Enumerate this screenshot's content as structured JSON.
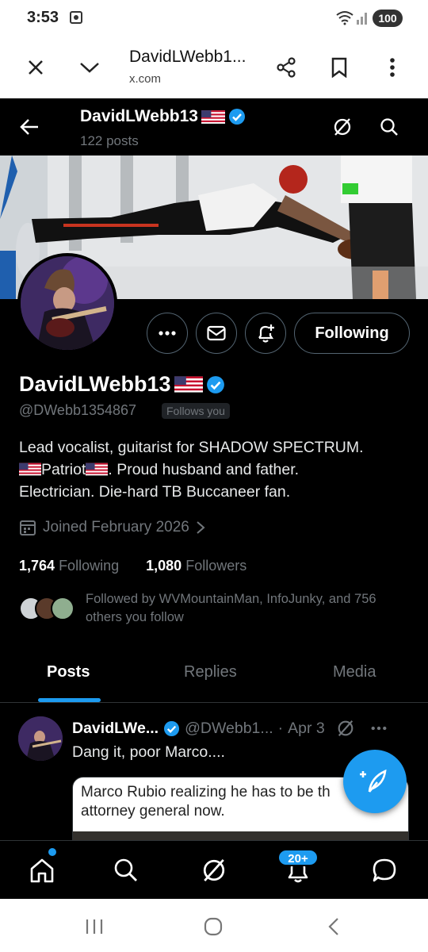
{
  "status_bar": {
    "time": "3:53",
    "battery": "100"
  },
  "browser": {
    "page_title": "DavidLWebb1...",
    "host": "x.com"
  },
  "header": {
    "name": "DavidLWebb13",
    "posts_count": "122 posts"
  },
  "profile": {
    "display_name": "DavidLWebb13",
    "handle": "@DWebb1354867",
    "follows_you": "Follows you",
    "follow_button": "Following",
    "bio_line1": "Lead vocalist, guitarist for SHADOW SPECTRUM.",
    "bio_patriot": "Patriot",
    "bio_line2_rest": ". Proud husband and father.",
    "bio_line3": "Electrician. Die-hard TB Buccaneer fan.",
    "joined": "Joined February 2026",
    "following_count": "1,764",
    "following_label": "Following",
    "followers_count": "1,080",
    "followers_label": "Followers",
    "followed_by": "Followed by WVMountainMan, InfoJunky, and 756 others you follow"
  },
  "tabs": [
    "Posts",
    "Replies",
    "Media"
  ],
  "active_tab": "Posts",
  "post": {
    "name": "DavidLWe...",
    "handle": "@DWebb1...",
    "separator": "·",
    "date": "Apr 3",
    "text": "Dang it, poor Marco....",
    "card_text": "Marco Rubio realizing he has to be th attorney general now."
  },
  "bottom_nav": {
    "notifications_badge": "20+"
  },
  "colors": {
    "accent": "#1d9bf0",
    "background": "#000000",
    "secondary_text": "#71767b"
  },
  "icons": [
    "close-icon",
    "chevron-down-icon",
    "share-icon",
    "bookmark-icon",
    "more-vert-icon",
    "back-arrow-icon",
    "grok-icon",
    "search-icon",
    "more-horiz-icon",
    "mail-icon",
    "bell-plus-icon",
    "verified-badge-icon",
    "flag-us-icon",
    "calendar-icon",
    "chevron-right-icon",
    "compose-icon",
    "home-icon",
    "bell-icon",
    "chat-icon"
  ]
}
